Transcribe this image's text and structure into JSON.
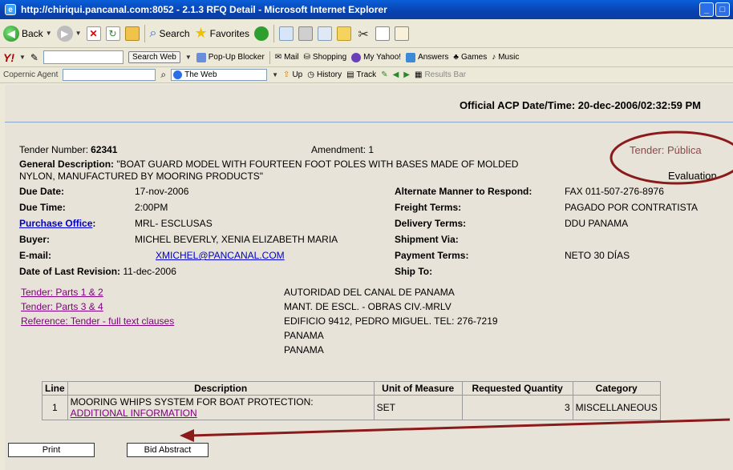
{
  "window": {
    "title": "http://chiriqui.pancanal.com:8052 - 2.1.3 RFQ Detail - Microsoft Internet Explorer"
  },
  "toolbar1": {
    "back": "Back",
    "search": "Search",
    "favorites": "Favorites"
  },
  "toolbar2": {
    "y_logo": "Y!",
    "search_web": "Search Web",
    "popup": "Pop-Up Blocker",
    "mail": "Mail",
    "shopping": "Shopping",
    "myyahoo": "My Yahoo!",
    "answers": "Answers",
    "games": "Games",
    "music": "Music"
  },
  "toolbar3": {
    "agent": "Copernic Agent",
    "the_web": "The Web",
    "up": "Up",
    "history": "History",
    "track": "Track",
    "results": "Results Bar"
  },
  "page": {
    "official_time": "Official ACP Date/Time: 20-dec-2006/02:32:59 PM",
    "tender_number_label": "Tender Number:",
    "tender_number": "62341",
    "amendment": "Amendment: 1",
    "tender_type": "Tender: Pública",
    "status": "Evaluation",
    "gen_desc_label": "General Description:",
    "gen_desc_1": "\"BOAT GUARD MODEL WITH FOURTEEN FOOT POLES WITH BASES MADE OF MOLDED",
    "gen_desc_2": "NYLON, MANUFACTURED BY MOORING PRODUCTS\"",
    "due_date_label": "Due Date:",
    "due_date": "17-nov-2006",
    "due_time_label": "Due Time:",
    "due_time": "2:00PM",
    "purchase_office_label": "Purchase Office",
    "purchase_office_colon": ":",
    "purchase_office": "MRL- ESCLUSAS",
    "buyer_label": "Buyer:",
    "buyer": "MICHEL BEVERLY, XENIA ELIZABETH MARIA",
    "email_label": "E-mail:",
    "email": "XMICHEL@PANCANAL.COM",
    "last_rev_label": "Date of Last Revision:",
    "last_rev": "11-dec-2006",
    "alt_label": "Alternate Manner to Respond:",
    "alt": "FAX 011-507-276-8976",
    "freight_label": "Freight Terms:",
    "freight": "PAGADO POR CONTRATISTA",
    "delivery_label": "Delivery Terms:",
    "delivery": "DDU PANAMA",
    "ship_via_label": "Shipment Via:",
    "payment_label": "Payment Terms:",
    "payment": "NETO 30 DÍAS",
    "ship_to_label": "Ship To:",
    "links": [
      "Tender: Parts 1 & 2",
      "Tender: Parts 3 & 4",
      "Reference: Tender - full text clauses"
    ],
    "address": [
      "AUTORIDAD DEL CANAL DE PANAMA",
      "MANT. DE ESCL. - OBRAS CIV.-MRLV",
      "EDIFICIO 9412, PEDRO MIGUEL. TEL: 276-7219",
      "PANAMA",
      "PANAMA"
    ]
  },
  "table": {
    "headers": [
      "Line",
      "Description",
      "Unit of Measure",
      "Requested Quantity",
      "Category"
    ],
    "rows": [
      {
        "line": "1",
        "desc": "MOORING WHIPS SYSTEM FOR BOAT PROTECTION:",
        "link": "ADDITIONAL INFORMATION",
        "uom": "SET",
        "qty": "3",
        "category": "MISCELLANEOUS"
      }
    ]
  },
  "buttons": {
    "print": "Print",
    "bid_abstract": "Bid Abstract"
  },
  "colors": {
    "annotation": "#8b1a1a",
    "titlebar": "#0a5fd8"
  }
}
